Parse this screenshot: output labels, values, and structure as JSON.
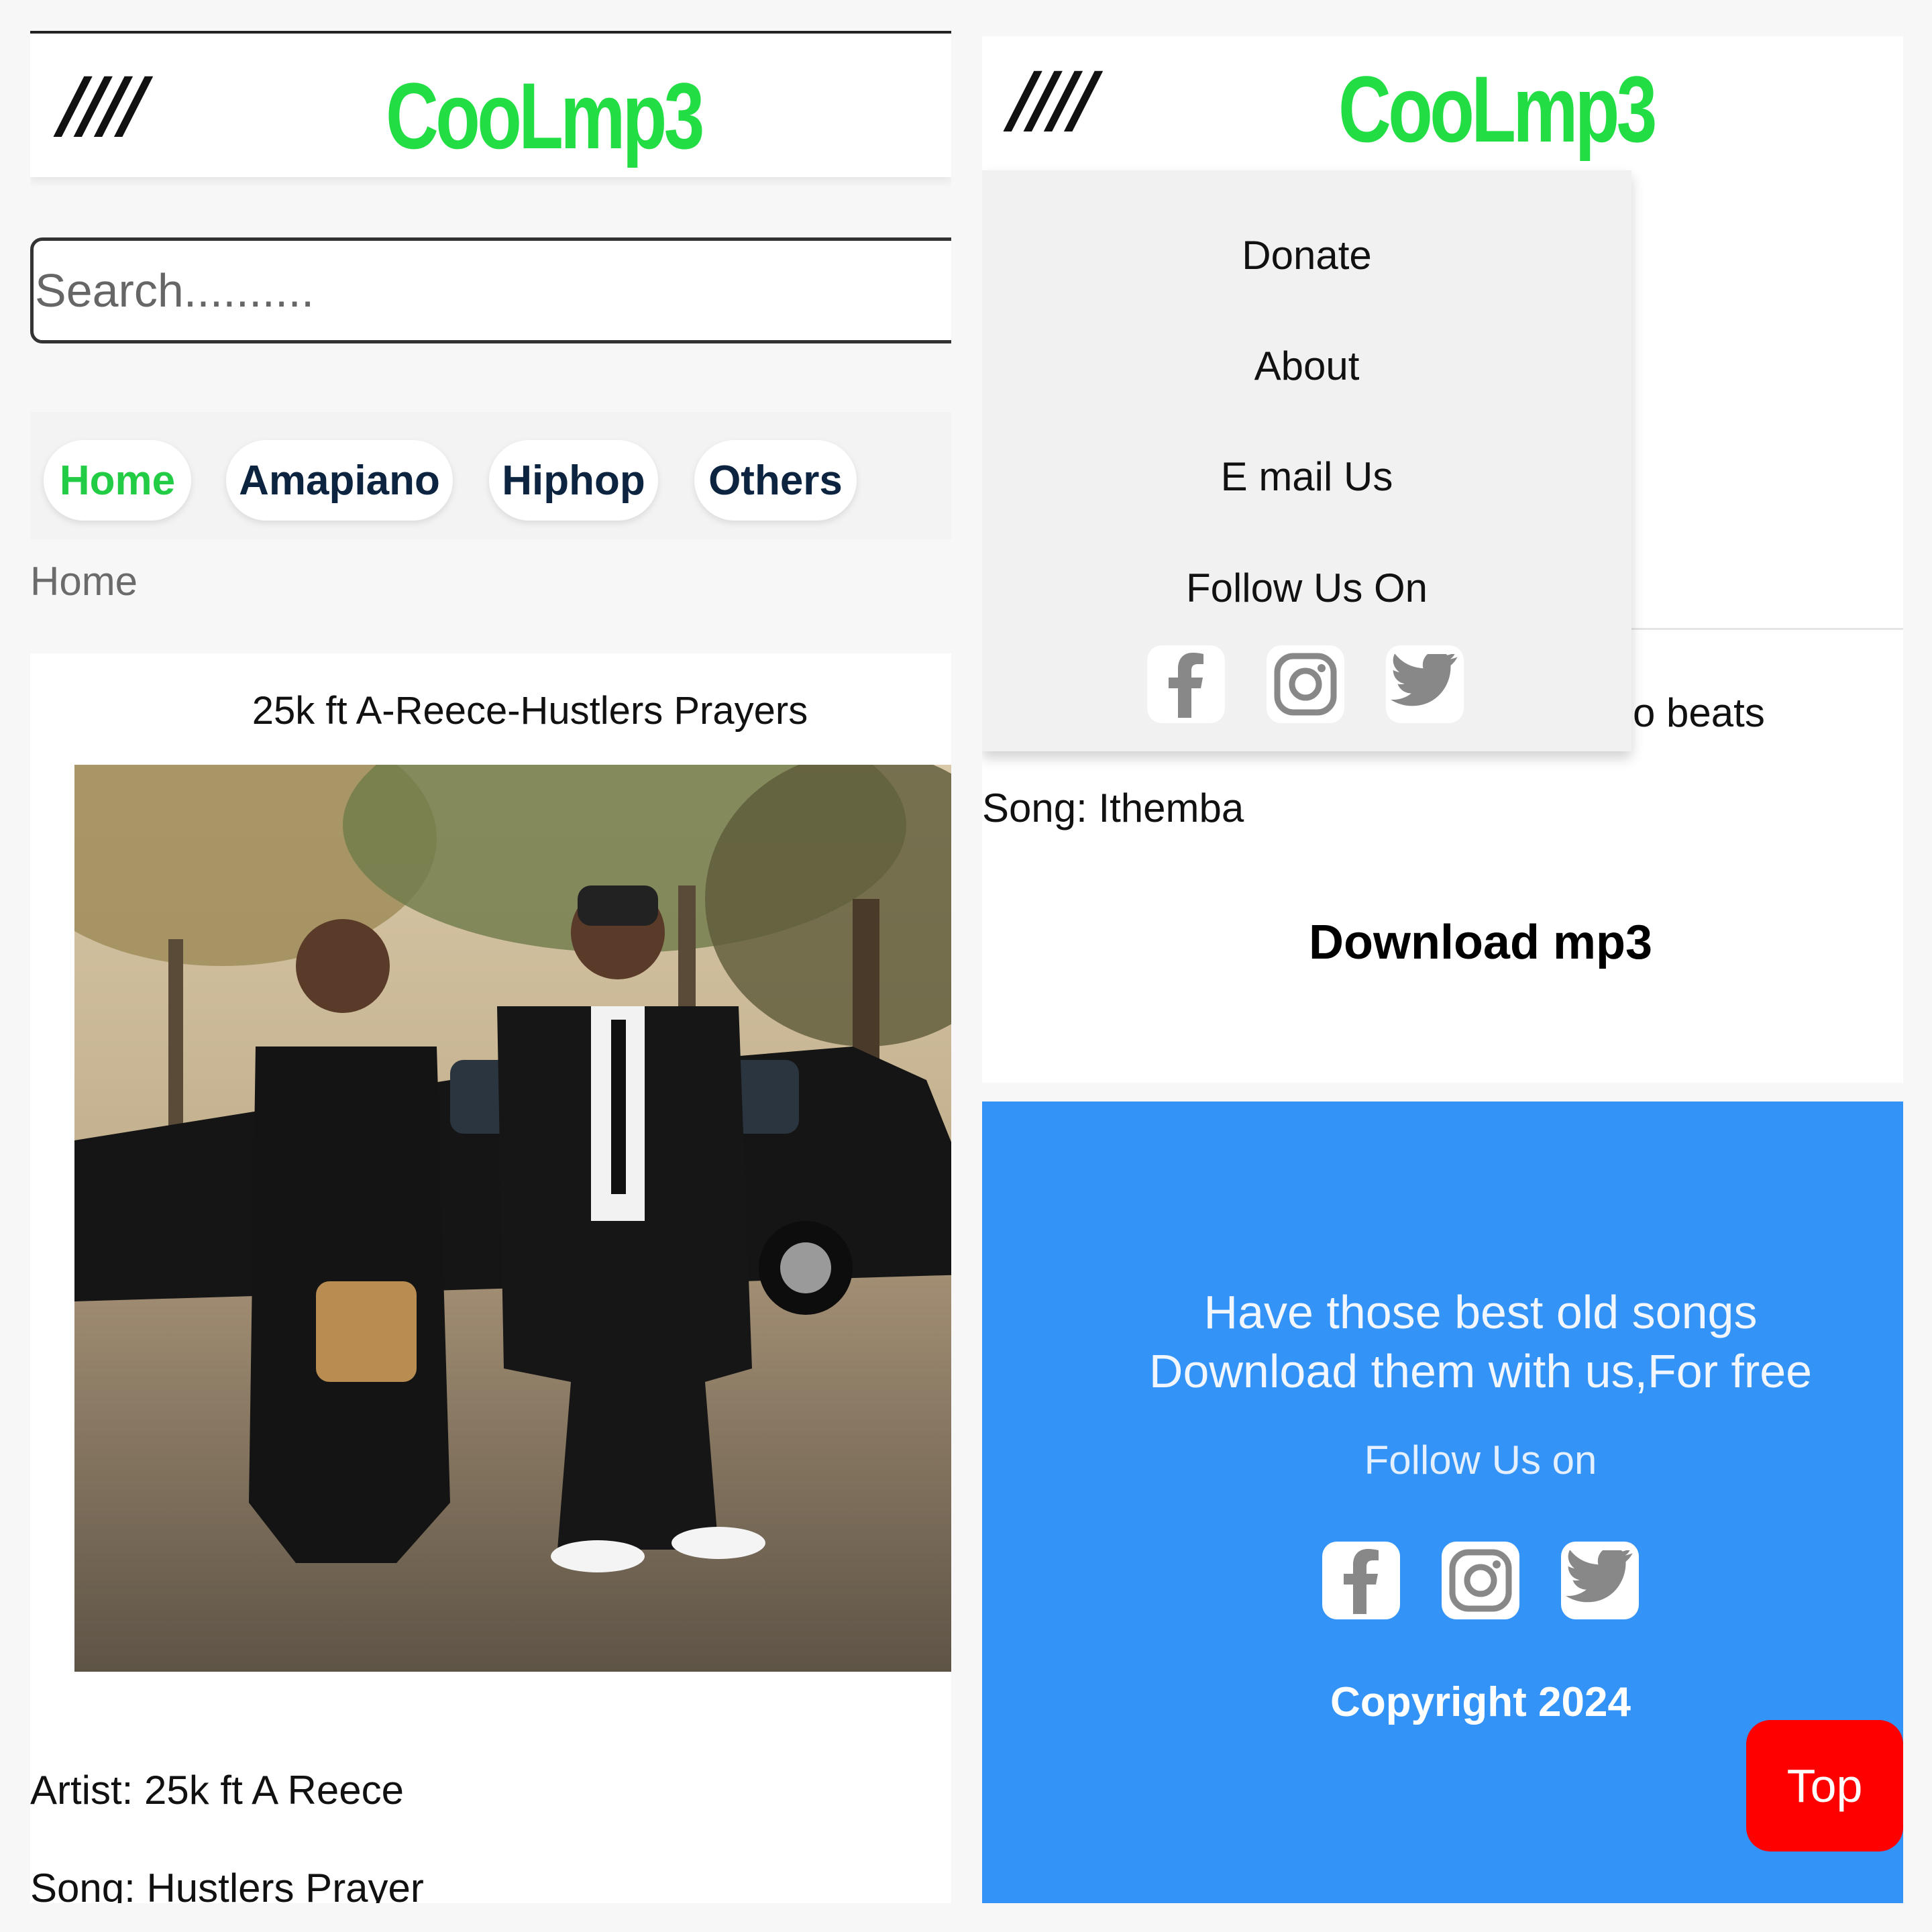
{
  "left_screen": {
    "menu_icon_text": "////",
    "logo": "CooLmp3",
    "search": {
      "placeholder": "Search..........",
      "value": ""
    },
    "nav": [
      "Home",
      "Amapiano",
      "Hiphop",
      "Others"
    ],
    "nav_active": "Home",
    "breadcrumb": "Home",
    "post": {
      "title": "25k ft A-Reece-Hustlers Prayers",
      "artist": "Artist: 25k ft A Reece",
      "song": "Song: Hustlers Prayer"
    }
  },
  "right_screen": {
    "menu_icon_text": "////",
    "logo": "CooLmp3",
    "menu": {
      "items": [
        "Donate",
        "About",
        "E mail Us"
      ],
      "follow_label": "Follow Us On",
      "social_icons": [
        "facebook-icon",
        "instagram-icon",
        "twitter-icon"
      ]
    },
    "partial_text": "o beats",
    "song": "Song: Ithemba",
    "download_label": "Download mp3",
    "footer": {
      "tagline_line1": "Have those best old songs",
      "tagline_line2": "Download them with us,For free",
      "follow_label": "Follow Us on",
      "social_icons": [
        "facebook-icon",
        "instagram-icon",
        "twitter-icon"
      ],
      "copyright": "Copyright 2024"
    },
    "top_button": "Top"
  },
  "colors": {
    "logo_green": "#22dd44",
    "nav_text": "#0c2440",
    "footer_blue": "#3393f7",
    "top_button_red": "#ff0000",
    "icon_gray": "#888888"
  }
}
